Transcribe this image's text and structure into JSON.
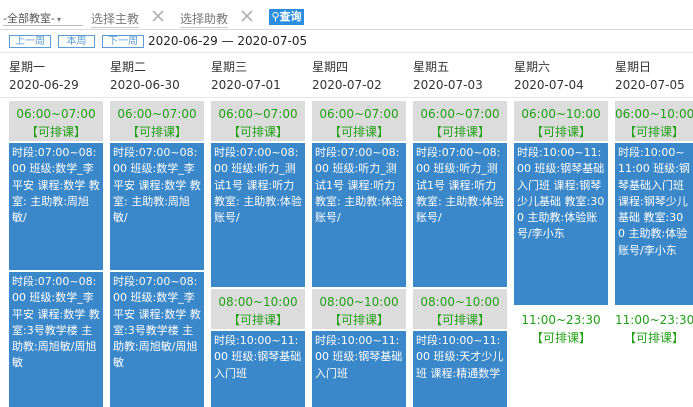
{
  "toolbar": {
    "campus_select": "-全部教室-",
    "teacher_filter": "选择主教",
    "assistant_filter": "选择助教",
    "search_label": "查询"
  },
  "nav": {
    "prev_week": "上一周",
    "this_week": "本周",
    "next_week": "下一周",
    "range": "2020-06-29 — 2020-07-05"
  },
  "days": [
    {
      "name": "星期一",
      "date": "2020-06-29"
    },
    {
      "name": "星期二",
      "date": "2020-06-30"
    },
    {
      "name": "星期三",
      "date": "2020-07-01"
    },
    {
      "name": "星期四",
      "date": "2020-07-02"
    },
    {
      "name": "星期五",
      "date": "2020-07-03"
    },
    {
      "name": "星期六",
      "date": "2020-07-04"
    },
    {
      "name": "星期日",
      "date": "2020-07-05"
    }
  ],
  "slots": {
    "available_label": "【可排课】",
    "mon_free": "06:00~07:00",
    "tue_free": "06:00~07:00",
    "wed_free1": "06:00~07:00",
    "wed_free2": "08:00~10:00",
    "thu_free1": "06:00~07:00",
    "thu_free2": "08:00~10:00",
    "fri_free1": "06:00~07:00",
    "fri_free2": "08:00~10:00",
    "sat_free1": "06:00~10:00",
    "sat_free2": "11:00~23:30",
    "sun_free1": "06:00~10:00",
    "sun_free2": "11:00~23:30"
  },
  "lessons": {
    "mon1": "时段:07:00~08:00 班级:数学_李平安 课程:数学 教室: 主助教:周旭敏/",
    "mon2": "时段:07:00~08:00 班级:数学_李平安 课程:数学 教室:3号教学楼 主助教:周旭敏/周旭敏",
    "tue1": "时段:07:00~08:00 班级:数学_李平安 课程:数学 教室: 主助教:周旭敏/",
    "tue2": "时段:07:00~08:00 班级:数学_李平安 课程:数学 教室:3号教学楼 主助教:周旭敏/周旭敏",
    "wed1": "时段:07:00~08:00 班级:听力_测试1号 课程:听力 教室: 主助教:体验账号/",
    "wed2": "时段:10:00~11:00 班级:钢琴基础入门班",
    "thu1": "时段:07:00~08:00 班级:听力_测试1号 课程:听力 教室: 主助教:体验账号/",
    "thu2": "时段:10:00~11:00 班级:钢琴基础入门班",
    "fri1": "时段:07:00~08:00 班级:听力_测试1号 课程:听力 教室: 主助教:体验账号/",
    "fri2": "时段:10:00~11:00 班级:天才少儿班 课程:精通数学",
    "sat1": "时段:10:00~11:00 班级:钢琴基础入门班 课程:钢琴少儿基础 教室:300 主助教:体验账号/李小东",
    "sun1": "时段:10:00~11:00 班级:钢琴基础入门班 课程:钢琴少儿基础 教室:300 主助教:体验账号/李小东"
  },
  "colors": {
    "accent": "#2e8ede",
    "booked": "#3a87c9",
    "free_bg": "#dcdcdc",
    "free_text": "#22a016"
  }
}
